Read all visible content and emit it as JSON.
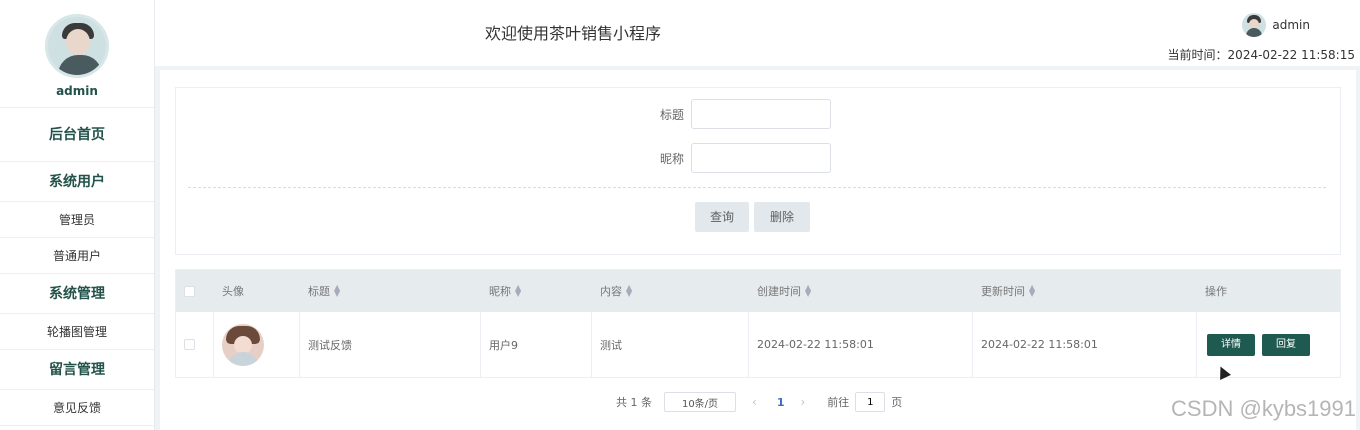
{
  "sidebar": {
    "username": "admin",
    "menu_home": "后台首页",
    "groups": [
      {
        "title": "系统用户",
        "items": [
          "管理员",
          "普通用户"
        ]
      },
      {
        "title": "系统管理",
        "items": [
          "轮播图管理"
        ]
      },
      {
        "title": "留言管理",
        "items": [
          "意见反馈"
        ]
      }
    ]
  },
  "header": {
    "title": "欢迎使用茶叶销售小程序",
    "username": "admin",
    "time_label": "当前时间：2024-02-22 11:58:15"
  },
  "search": {
    "fields": [
      {
        "label": "标题",
        "value": ""
      },
      {
        "label": "昵称",
        "value": ""
      }
    ],
    "query_label": "查询",
    "delete_label": "删除"
  },
  "table": {
    "columns": [
      "头像",
      "标题",
      "昵称",
      "内容",
      "创建时间",
      "更新时间",
      "操作"
    ],
    "rows": [
      {
        "title": "测试反馈",
        "nickname": "用户9",
        "content": "测试",
        "created": "2024-02-22 11:58:01",
        "updated": "2024-02-22 11:58:01",
        "actions": [
          "详情",
          "回复"
        ]
      }
    ]
  },
  "pagination": {
    "total": "共 1 条",
    "page_size": "10条/页",
    "current_page": "1",
    "goto_label": "前往",
    "goto_value": "1",
    "goto_suffix": "页"
  },
  "watermark": "CSDN @kybs1991",
  "colors": {
    "accent": "#1f5a50",
    "menu_text": "#23524a",
    "table_header": "#e6ecee"
  }
}
